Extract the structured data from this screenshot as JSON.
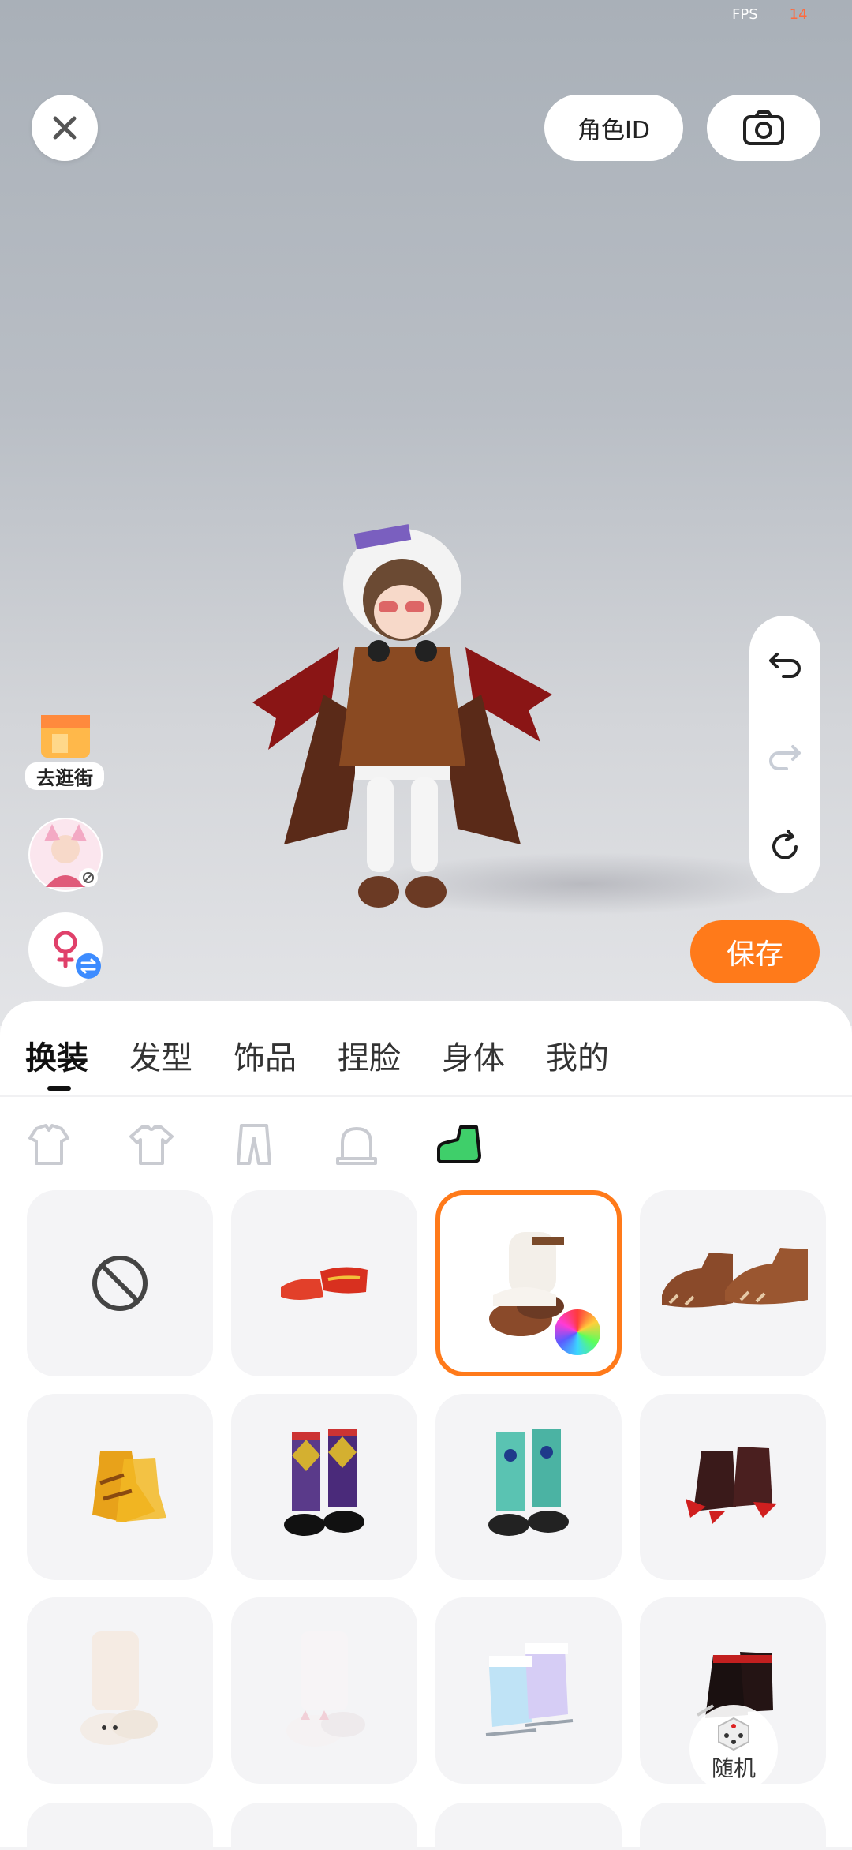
{
  "status": {
    "fps_label": "FPS",
    "fps_value": "14"
  },
  "header": {
    "close_icon": "close-icon",
    "role_id_label": "角色ID",
    "camera_icon": "camera-icon"
  },
  "left_tools": {
    "shop_label": "去逛街",
    "avatar_icon": "avatar-icon",
    "gender_icon": "female-switch-icon"
  },
  "right_tools": {
    "undo_icon": "undo-icon",
    "redo_icon": "redo-icon",
    "reset_icon": "rotate-icon"
  },
  "save_label": "保存",
  "tabs": [
    {
      "label": "换装",
      "active": true
    },
    {
      "label": "发型",
      "active": false
    },
    {
      "label": "饰品",
      "active": false
    },
    {
      "label": "捏脸",
      "active": false
    },
    {
      "label": "身体",
      "active": false
    },
    {
      "label": "我的",
      "active": false
    }
  ],
  "categories": [
    "outfit-set-icon",
    "shirt-icon",
    "pants-icon",
    "gloves-icon",
    "shoes-icon"
  ],
  "items": [
    {
      "name": "none",
      "selected": false
    },
    {
      "name": "red-shoes",
      "selected": false
    },
    {
      "name": "white-fur-boots",
      "selected": true
    },
    {
      "name": "brown-paw-shoes",
      "selected": false
    },
    {
      "name": "yellow-boots",
      "selected": false
    },
    {
      "name": "argyle-socks",
      "selected": false
    },
    {
      "name": "teal-socks",
      "selected": false
    },
    {
      "name": "red-claw-shoes",
      "selected": false
    },
    {
      "name": "bunny-slippers",
      "selected": false
    },
    {
      "name": "cat-slippers",
      "selected": false
    },
    {
      "name": "holo-boots",
      "selected": false
    },
    {
      "name": "black-red-boots",
      "selected": false
    }
  ],
  "random_label": "随机",
  "colors": {
    "accent": "#ff7a1a",
    "fps_value": "#ff6a3d"
  }
}
